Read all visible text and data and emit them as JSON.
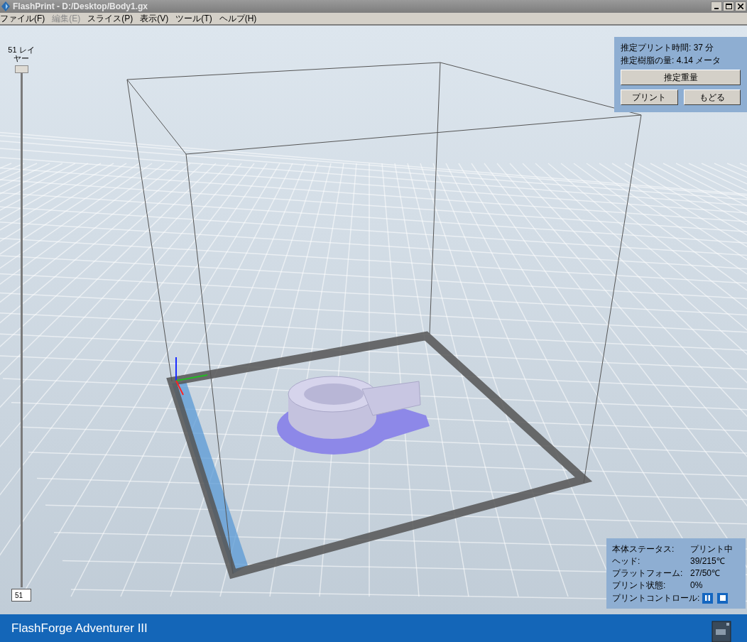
{
  "window": {
    "title": "FlashPrint - D:/Desktop/Body1.gx"
  },
  "menu": [
    {
      "label": "ファイル(F)",
      "disabled": false
    },
    {
      "label": "編集(E)",
      "disabled": true
    },
    {
      "label": "スライス(P)",
      "disabled": false
    },
    {
      "label": "表示(V)",
      "disabled": false
    },
    {
      "label": "ツール(T)",
      "disabled": false
    },
    {
      "label": "ヘルプ(H)",
      "disabled": false
    }
  ],
  "layer_slider": {
    "label": "51 レイヤー",
    "level": 1,
    "value": "51"
  },
  "estimate_panel": {
    "lines": [
      {
        "label": "推定プリント時間:",
        "value": "37 分"
      },
      {
        "label": "推定樹脂の量:",
        "value": "4.14 メータ"
      }
    ],
    "weight_button": "推定重量",
    "print_button": "プリント",
    "back_button": "もどる"
  },
  "status_panel": {
    "rows": [
      {
        "label": "本体ステータス:",
        "value": "プリント中"
      },
      {
        "label": "ヘッド:",
        "value": "39/215℃"
      },
      {
        "label": "プラットフォーム:",
        "value": "27/50℃"
      },
      {
        "label": "プリント状態:",
        "value": "0%"
      }
    ],
    "control_label": "プリントコントロール:"
  },
  "footer": {
    "printer_name": "FlashForge Adventurer III"
  }
}
